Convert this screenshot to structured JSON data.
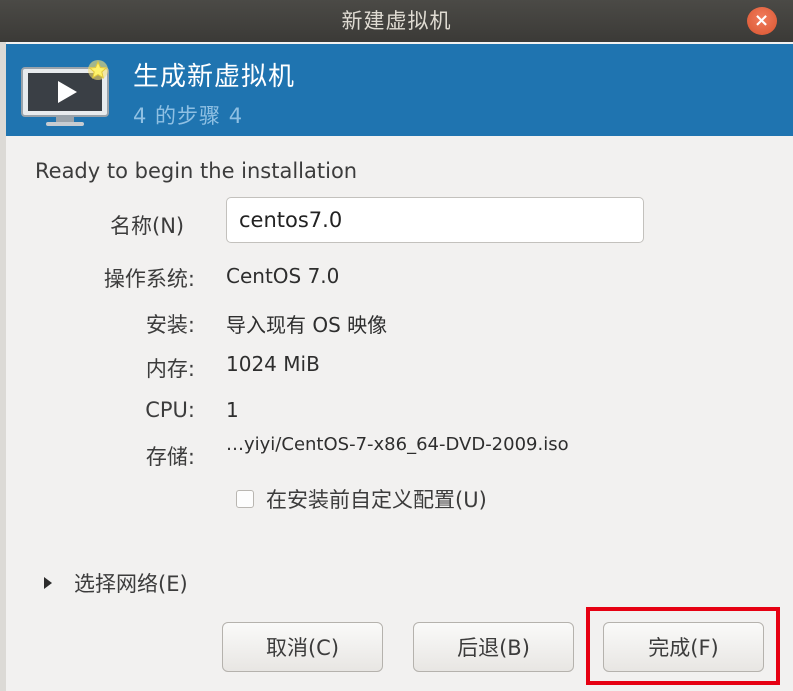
{
  "window": {
    "title": "新建虚拟机",
    "close_symbol": "×"
  },
  "header": {
    "icon": "monitor-play-icon",
    "title": "生成新虚拟机",
    "step": "4 的步骤 4"
  },
  "summary": {
    "heading": "Ready to begin the installation",
    "name_label": "名称(N)",
    "name_value": "centos7.0",
    "rows": [
      {
        "label": "操作系统:",
        "value": "CentOS 7.0"
      },
      {
        "label": "安装:",
        "value": "导入现有 OS 映像"
      },
      {
        "label": "内存:",
        "value": "1024 MiB"
      },
      {
        "label": "CPU:",
        "value": "1"
      },
      {
        "label": "存储:",
        "value": "…yiyi/CentOS-7-x86_64-DVD-2009.iso"
      }
    ],
    "customize_label": "在安装前自定义配置(U)",
    "customize_checked": false,
    "network_label": "选择网络(E)"
  },
  "buttons": {
    "cancel": "取消(C)",
    "back": "后退(B)",
    "finish": "完成(F)"
  },
  "colors": {
    "header_bg": "#1f74b0",
    "highlight": "#e60012",
    "close": "#e0603a"
  }
}
